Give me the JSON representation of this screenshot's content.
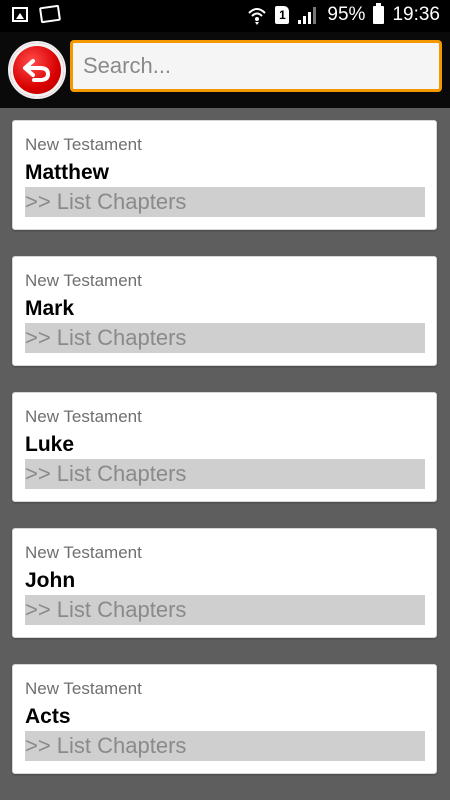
{
  "status_bar": {
    "battery_percent": "95%",
    "time": "19:36",
    "sim_label": "1",
    "icons": [
      "image-icon",
      "notes-icon",
      "wifi-icon",
      "sim-icon",
      "signal-icon",
      "battery-charging-icon"
    ]
  },
  "top_bar": {
    "back_icon": "back-arrow-icon",
    "search_placeholder": "Search...",
    "accent_color": "#f39800",
    "back_color": "#d80000"
  },
  "books": [
    {
      "section": "New Testament",
      "title": "Matthew",
      "action": ">> List Chapters"
    },
    {
      "section": "New Testament",
      "title": "Mark",
      "action": ">> List Chapters"
    },
    {
      "section": "New Testament",
      "title": "Luke",
      "action": ">> List Chapters"
    },
    {
      "section": "New Testament",
      "title": "John",
      "action": ">> List Chapters"
    },
    {
      "section": "New Testament",
      "title": "Acts",
      "action": ">> List Chapters"
    }
  ]
}
